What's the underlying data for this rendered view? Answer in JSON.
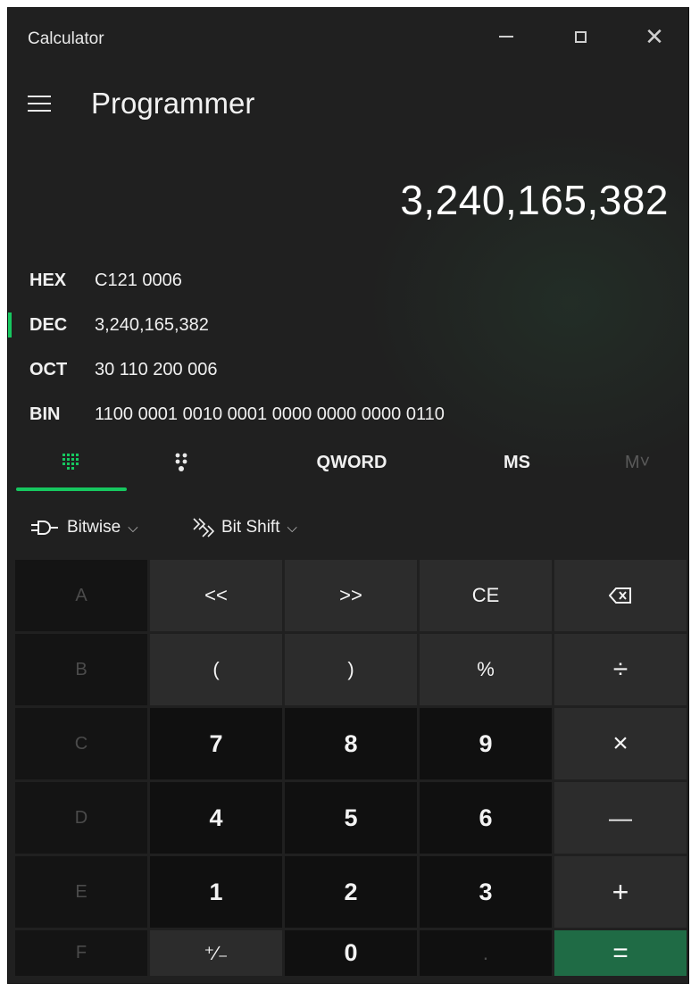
{
  "window": {
    "title": "Calculator"
  },
  "header": {
    "mode": "Programmer"
  },
  "display": {
    "value": "3,240,165,382"
  },
  "radix": [
    {
      "label": "HEX",
      "value": "C121 0006",
      "selected": false
    },
    {
      "label": "DEC",
      "value": "3,240,165,382",
      "selected": true
    },
    {
      "label": "OCT",
      "value": "30 110 200 006",
      "selected": false
    },
    {
      "label": "BIN",
      "value": "1100 0001 0010 0001 0000 0000 0000 0110",
      "selected": false
    }
  ],
  "tabs": {
    "keypad_icon": "keypad-grid-icon",
    "bit_toggle_icon": "bit-toggle-icon",
    "word_size": "QWORD",
    "memory_store": "MS",
    "memory_recall": "M˅"
  },
  "toolbar": {
    "bitwise_label": "Bitwise",
    "bitshift_label": "Bit Shift"
  },
  "keys": {
    "A": "A",
    "lshift": "<<",
    "rshift": ">>",
    "CE": "CE",
    "backspace": "⌫",
    "B": "B",
    "lparen": "(",
    "rparen": ")",
    "percent": "%",
    "divide": "÷",
    "C": "C",
    "seven": "7",
    "eight": "8",
    "nine": "9",
    "multiply": "×",
    "D": "D",
    "four": "4",
    "five": "5",
    "six": "6",
    "minus": "—",
    "E": "E",
    "one": "1",
    "two": "2",
    "three": "3",
    "plus": "+",
    "F": "F",
    "negate": "⁺∕₋",
    "zero": "0",
    "decimal": ".",
    "equals": "="
  },
  "colors": {
    "accent": "#16c75f",
    "equals_bg": "#1f6b45",
    "window_bg": "#202020"
  }
}
